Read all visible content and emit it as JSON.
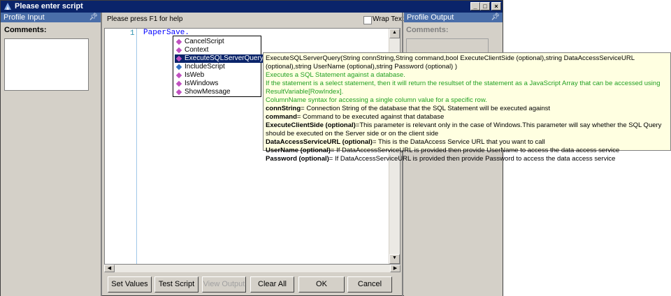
{
  "window": {
    "title": "Please enter script",
    "buttons": [
      "_",
      "□",
      "×"
    ]
  },
  "profile_input": {
    "header": "Profile Input",
    "comments_label": "Comments:"
  },
  "profile_output": {
    "header": "Profile Output",
    "comments_label": "Comments:"
  },
  "editor": {
    "help_text": "Please press F1 for help",
    "wrap_text_label": "Wrap Text",
    "line_number": "1",
    "code": "PaperSave."
  },
  "autocomplete": {
    "items": [
      "CancelScript",
      "Context",
      "ExecuteSQLServerQuery",
      "IncludeScript",
      "IsWeb",
      "IsWindows",
      "ShowMessage"
    ],
    "selected": "ExecuteSQLServerQuery"
  },
  "tooltip": {
    "signature": "ExecuteSQLServerQuery(String connString,String command,bool ExecuteClientSide (optional),string DataAccessServiceURL (optional),string UserName (optional),string Password (optional) )",
    "desc1": "Executes a SQL Statement against a database.",
    "desc2": "If the statement is a select statement, then it will return the resultset of the statement as a JavaScript Array that can be accessed using ResultVariable[RowIndex].",
    "desc3": "ColumnName syntax for accessing a single column value for a specific row.",
    "params": [
      {
        "name": "connString",
        "text": "= Connection String of the database that the SQL Statement will be executed against"
      },
      {
        "name": "command",
        "text": "= Command to be executed against that database"
      },
      {
        "name": "ExecuteClientSide (optional)",
        "text": "=This parameter is relevant only in the case of Windows.This parameter will say whether the SQL Query should be executed on the Server side or on the client side"
      },
      {
        "name": "DataAccessServiceURL (optional)",
        "text": "= This is the DataAccess Service URL that you want to call"
      },
      {
        "name": "UserName (optional)",
        "text": "= If DataAccessServiceURL is provided then provide UserName to access the data access service"
      },
      {
        "name": "Password (optional)",
        "text": "= If DataAccessServiceURL is provided then provide Password to access the data access service"
      }
    ]
  },
  "buttons": {
    "set_values": "Set Values",
    "test_script": "Test Script",
    "view_output": "View Output",
    "clear_all": "Clear All",
    "ok": "OK",
    "cancel": "Cancel"
  }
}
